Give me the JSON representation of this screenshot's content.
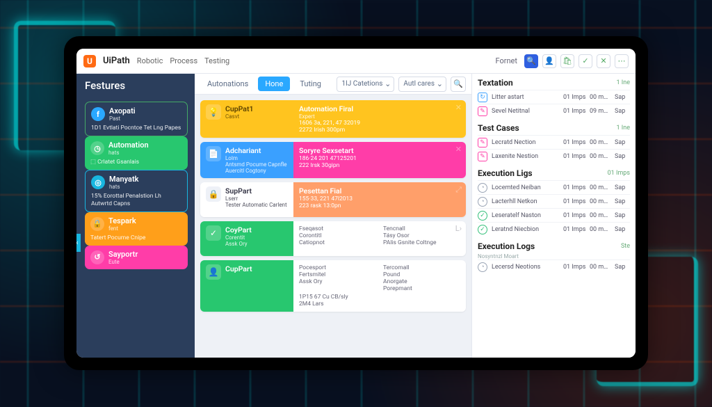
{
  "brand": {
    "mark": "U",
    "name": "UiPath"
  },
  "top_nav": [
    "Robotic",
    "Process",
    "Testing"
  ],
  "top_right_label": "Fornet",
  "top_icons": [
    {
      "name": "search-icon",
      "glyph": "🔍",
      "primary": true
    },
    {
      "name": "user-icon",
      "glyph": "👤"
    },
    {
      "name": "bag-icon",
      "glyph": "🛍"
    },
    {
      "name": "check-icon",
      "glyph": "✓"
    },
    {
      "name": "close-icon",
      "glyph": "✕"
    },
    {
      "name": "more-icon",
      "glyph": "⋯"
    }
  ],
  "sidebar": {
    "title": "Festures",
    "items": [
      {
        "icon": "f",
        "title": "Axopati",
        "sub": "Past",
        "desc": "1D1 Evtlati Pocntce Tet Lng Papes",
        "bg": "transparent",
        "fg": "#ffffff",
        "ibg": "#2aa8ff",
        "border": "#4a6"
      },
      {
        "icon": "◷",
        "title": "Automation",
        "sub": "hats",
        "desc": "⬚ Crlatet Gsanlais",
        "bg": "#28c76f",
        "fg": "#ffffff",
        "ibg": "#ffffff33"
      },
      {
        "icon": "◎",
        "title": "Manyatk",
        "sub": "hats",
        "desc": "15% Eorottal Penalstion Lh Autwrtd Capns",
        "bg": "transparent",
        "fg": "#ffffff",
        "ibg": "#18b6e0",
        "border": "#18b6e0"
      },
      {
        "icon": "🔒",
        "title": "Tespark",
        "sub": "fent",
        "desc": "Tatert Pocume Cnipe",
        "bg": "#ff9f1a",
        "fg": "#ffffff",
        "ibg": "#ffffff33"
      },
      {
        "icon": "↺",
        "title": "Sayportr",
        "sub": "Eute",
        "desc": "",
        "bg": "#ff3da8",
        "fg": "#ffffff",
        "ibg": "#ffffff33"
      }
    ]
  },
  "tabs": {
    "items": [
      "Autonations",
      "Hone",
      "Tuting"
    ],
    "active_index": 1,
    "right": {
      "select1": "1IJ Catetions",
      "select2": "Autl cares"
    }
  },
  "cards": [
    {
      "left_bg": "#ffc41f",
      "left_fg": "#5b4200",
      "icon": "💡",
      "title": "CupPat1",
      "sub": "Casvt",
      "body_bg": "#ffc41f",
      "body_title": "Automation Firal",
      "body_sub": "Expert",
      "lines": [
        "1606 3a, 221, 47 32019",
        "2272 Irish 300pm"
      ],
      "close": "✕"
    },
    {
      "left_bg": "#3aa0ff",
      "left_fg": "#ffffff",
      "icon": "📄",
      "title": "Adchariant",
      "sub": "Lolm",
      "body_bg": "#ff3da8",
      "body_title": "Soryre Sexsetart",
      "body_sub": "",
      "lines": [
        "186·24 201 47125201",
        "222 Irsk 30gipn"
      ],
      "close": "✕",
      "left_desc": [
        "Antsmd Pocume Capnfle",
        "Auercitl Cogtony"
      ]
    },
    {
      "left_bg": "#ffffff",
      "left_fg": "#334",
      "icon": "🔒",
      "title": "SupPart",
      "sub": "Lserr",
      "body_bg": "#ff9f6a",
      "body_title": "Pesettan Fial",
      "body_sub": "",
      "lines": [
        "155·33, 221 47l2013",
        "223 rask 13:0pn"
      ],
      "close": "⤢",
      "left_desc": [
        "Tester Automatic Carlent"
      ]
    },
    {
      "left_bg": "#28c76f",
      "left_fg": "#ffffff",
      "icon": "✓",
      "title": "CoyPart",
      "sub": "",
      "body_bg": "#ffffff",
      "body_fg": "#667",
      "cols": [
        [
          "Fseqasot",
          "Corontitl",
          "Catiopnot"
        ],
        [
          "Tencnall",
          "Tásy Osor",
          "PAlis Gsnite Coltnge"
        ]
      ],
      "close": "L›",
      "left_desc": [
        "Corentit",
        "Assk Ory"
      ]
    },
    {
      "left_bg": "#28c76f",
      "left_fg": "#ffffff",
      "icon": "👤",
      "title": "CupPart",
      "sub": "",
      "body_bg": "#ffffff",
      "body_fg": "#667",
      "cols": [
        [
          "Pocesport",
          "Fertsmitel",
          "Assk Ory"
        ],
        [
          "Tercomall",
          "Pound",
          "Anorgate",
          "Porepmant"
        ],
        [
          "1P15 67 Cu CB/sly",
          "2M4 Lars"
        ]
      ],
      "close": "",
      "left_desc": []
    }
  ],
  "right_panel": {
    "sections": [
      {
        "title": "Textation",
        "link": "1 Ine",
        "icon_style": "blue",
        "rows": [
          {
            "ic": "↻",
            "label": "Litter astart",
            "c1": "01 Imps",
            "c2": "00 m…",
            "c3": "Sap"
          },
          {
            "ic": "✎",
            "label": "Sevel Netitnal",
            "c1": "01 Imps",
            "c2": "09 m…",
            "c3": "Sap",
            "style": "pink"
          }
        ]
      },
      {
        "title": "Test Cases",
        "link": "1 Ine",
        "icon_style": "pink",
        "rows": [
          {
            "ic": "✎",
            "label": "Lecratd Nection",
            "c1": "01 Imps",
            "c2": "00 m…",
            "c3": "Sap"
          },
          {
            "ic": "✎",
            "label": "Laxenite Nestion",
            "c1": "01 Imps",
            "c2": "00 m…",
            "c3": "Sap"
          }
        ]
      },
      {
        "title": "Execution Ligs",
        "link": "01 Imps",
        "icon_style": "clock",
        "rows": [
          {
            "ic": "◔",
            "label": "Locemted Neiban",
            "c1": "01 Imps",
            "c2": "00 m…",
            "c3": "Sap"
          },
          {
            "ic": "◔",
            "label": "Lacterhll Netkon",
            "c1": "01 Imps",
            "c2": "00 m…",
            "c3": "Sap"
          },
          {
            "ic": "✓",
            "label": "Leseratelf Naston",
            "c1": "01 Imps",
            "c2": "00 m…",
            "c3": "Sap",
            "style": "ok"
          },
          {
            "ic": "✓",
            "label": "Leratnd Niecbion",
            "c1": "01 Imps",
            "c2": "00 m…",
            "c3": "Sap",
            "style": "ok"
          }
        ]
      },
      {
        "title": "Execution Logs",
        "link": "Ste",
        "icon_style": "clock",
        "sub": "Nosyntnzl Moart",
        "rows": [
          {
            "ic": "◔",
            "label": "Lecersd Neotions",
            "c1": "01 Imps",
            "c2": "00 m…",
            "c3": "Sap"
          }
        ]
      }
    ]
  }
}
